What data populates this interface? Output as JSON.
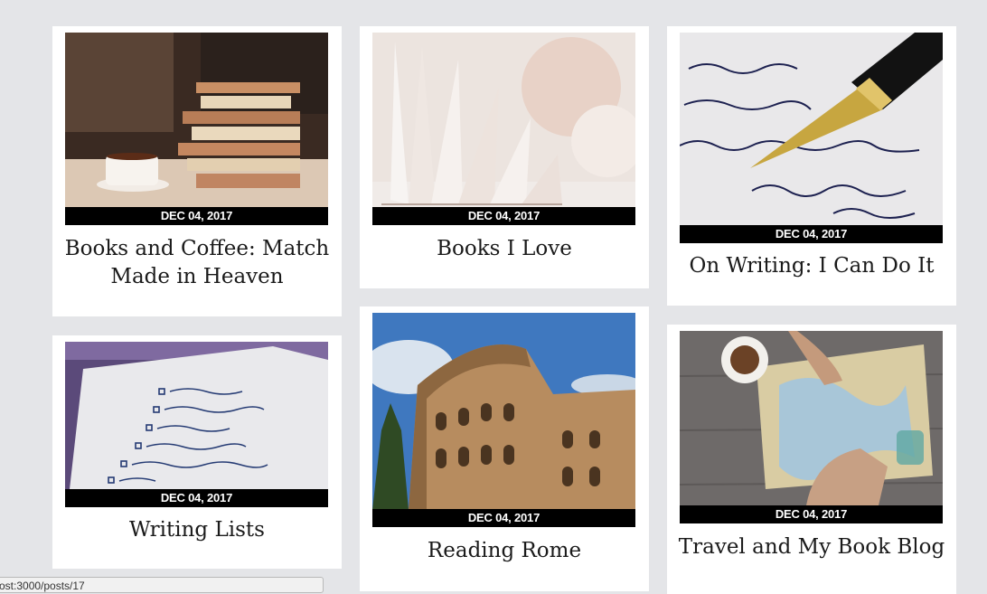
{
  "posts": [
    {
      "title": "Books and Coffee: Match Made in Heaven",
      "date": "DEC 04, 2017",
      "image": "books-and-coffee-photo"
    },
    {
      "title": "Books I Love",
      "date": "DEC 04, 2017",
      "image": "open-book-photo"
    },
    {
      "title": "On Writing: I Can Do It",
      "date": "DEC 04, 2017",
      "image": "fountain-pen-photo"
    },
    {
      "title": "Writing Lists",
      "date": "DEC 04, 2017",
      "image": "handwritten-list-photo"
    },
    {
      "title": "Reading Rome",
      "date": "DEC 04, 2017",
      "image": "colosseum-photo"
    },
    {
      "title": "Travel and My Book Blog",
      "date": "DEC 04, 2017",
      "image": "travel-map-photo"
    }
  ],
  "status_bar": {
    "url": "ost:3000/posts/17"
  }
}
